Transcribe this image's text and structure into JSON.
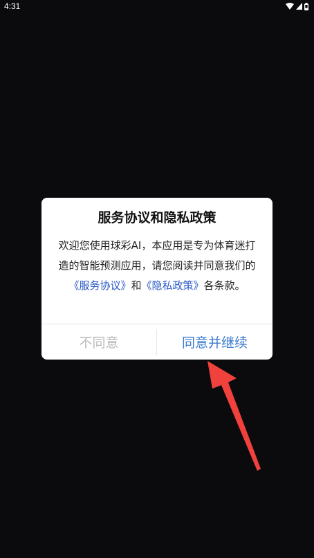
{
  "status_bar": {
    "time": "4:31",
    "icons": [
      "wifi-icon",
      "signal-icon",
      "battery-icon"
    ]
  },
  "dialog": {
    "title": "服务协议和隐私政策",
    "body_prefix": "欢迎您使用球彩AI，本应用是专为体育迷打造的智能预测应用，请您阅读并同意我们的",
    "service_link": "《服务协议》",
    "and_text": "和",
    "privacy_link": "《隐私政策》",
    "body_suffix": "各条款。",
    "disagree_label": "不同意",
    "agree_label": "同意并继续"
  },
  "colors": {
    "background": "#0b0b0d",
    "link": "#2757c5",
    "agree": "#3b7ad0",
    "disagree": "#b9b9b9",
    "annotation_arrow": "#f0413d"
  }
}
